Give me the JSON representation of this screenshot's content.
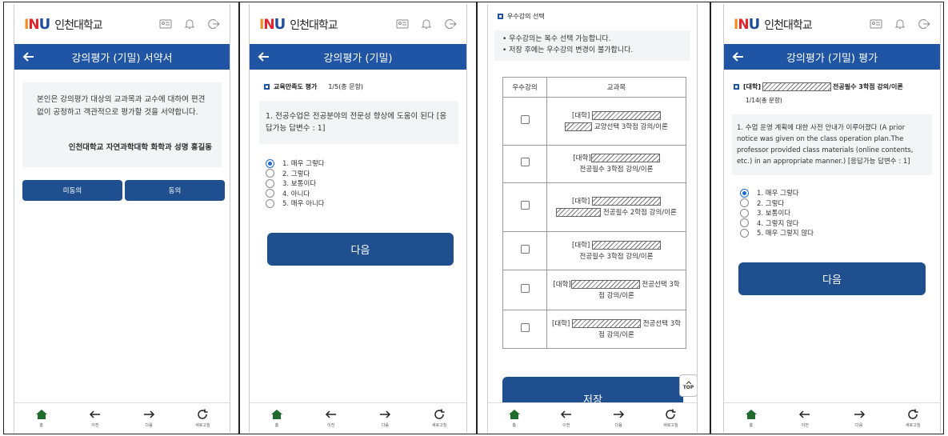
{
  "app": {
    "logo_text": "INU",
    "univ_name": "인천대학교"
  },
  "nav": [
    {
      "label": "홈"
    },
    {
      "label": "이전"
    },
    {
      "label": "다음"
    },
    {
      "label": "새로고침"
    }
  ],
  "screen1": {
    "title": "강의평가 (기밀) 서약서",
    "pledge_text": "본인은 강의평가 대상의 교과목과 교수에 대하여 편견없이 공정하고 객관적으로 평가할 것을 서약합니다.",
    "signature": "인천대학교 자연과학대학 화학과 성명 홍길동",
    "disagree_label": "미동의",
    "agree_label": "동의"
  },
  "screen2": {
    "title": "강의평가 (기밀)",
    "section_label": "교육만족도 평가",
    "count": "1/5(총 문항)",
    "question": "1. 전공수업은 전공분야의 전문성 향상에 도움이 된다 [응답가능 답변수 : 1]",
    "options": [
      "1. 매우 그렇다",
      "2. 그렇다",
      "3. 보통이다",
      "4. 아니다",
      "5. 매우 아니다"
    ],
    "selected_index": 0,
    "next_label": "다음"
  },
  "screen3": {
    "section_label": "우수강의 선택",
    "notes": [
      "• 우수강의는 복수 선택 가능합니다.",
      "• 저장 후에는 우수강의 변경이 불가합니다."
    ],
    "col_select": "우수강의",
    "col_course": "교과목",
    "rows": [
      {
        "prefix": "[대학]",
        "suffix": "교양선택 3학점 강의/이론"
      },
      {
        "prefix": "[대학]",
        "suffix": "전공필수 3학점 강의/이론"
      },
      {
        "prefix": "[대학]",
        "suffix": "전공필수 2학점 강의/이론"
      },
      {
        "prefix": "[대학]",
        "suffix": "전공필수 3학점 강의/이론"
      },
      {
        "prefix": "[대학]",
        "suffix": "전공선택 3학점 강의/이론"
      },
      {
        "prefix": "[대학]",
        "suffix": "전공선택 3학점 강의/이론"
      }
    ],
    "save_label": "저장",
    "top_label": "TOP"
  },
  "screen4": {
    "title": "강의평가 (기밀) 평가",
    "course_prefix": "[대학]",
    "course_suffix": "전공필수 3학점 강의/이론",
    "count": "1/14(총 문항)",
    "question": "1. 수업 운영 계획에 대한 사전 안내가 이루어졌다 (A prior notice was given on the class operation plan.The professor provided class materials (online contents, etc.) in an appropriate manner.) [응답가능 답변수 : 1]",
    "options": [
      "1. 매우 그렇다",
      "2. 그렇다",
      "3. 보통이다",
      "4. 그렇지 않다",
      "5. 매우 그렇지 않다"
    ],
    "selected_index": 0,
    "next_label": "다음"
  },
  "colors": {
    "primary": "#1f55a4",
    "button": "#1f4f8f",
    "radio_selected": "#1f6bd6"
  }
}
